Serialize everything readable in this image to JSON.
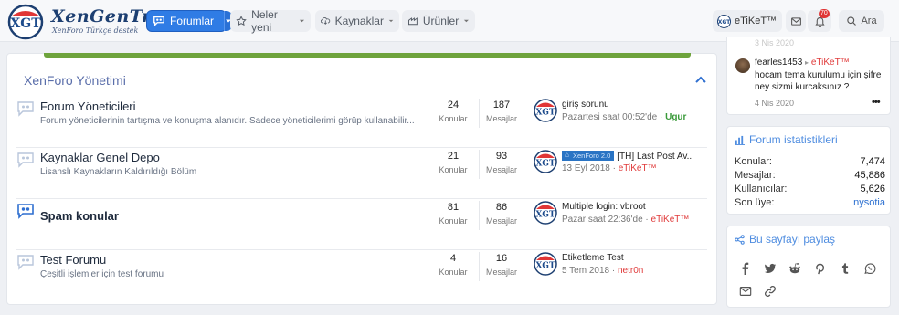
{
  "header": {
    "brand": "XenGenTr",
    "brand_sub": "XenForo Türkçe destek",
    "logo_text": "XGT",
    "nav": {
      "forums": "Forumlar",
      "whats_new": "Neler yeni",
      "resources": "Kaynaklar",
      "products": "Ürünler"
    },
    "user": "eTiKeT™",
    "alerts_count": "70",
    "search": "Ara"
  },
  "category": {
    "title": "XenForo Yönetimi",
    "counts_label": "Konular",
    "messages_label": "Mesajlar",
    "forums": [
      {
        "title": "Forum Yöneticileri",
        "desc": "Forum yöneticilerinin tartışma ve konuşma alanıdır. Sadece yöneticilerimi görüp kullanabilir...",
        "topics": "24",
        "messages": "187",
        "last_title": "giriş sorunu",
        "last_time": "Pazartesi saat 00:52'de · ",
        "last_user": "Ugur",
        "last_user_color": "#3a9a3a"
      },
      {
        "title": "Kaynaklar Genel Depo",
        "desc": "Lisanslı Kaynakların Kaldırıldığı Bölüm",
        "topics": "21",
        "messages": "93",
        "tag": "XenForo 2.0",
        "last_title": "[TH] Last Post Av...",
        "last_time": "13 Eyl 2018 · ",
        "last_user": "eTiKeT™",
        "last_user_color": "#e03a3a"
      },
      {
        "title": "Spam konular",
        "desc": "",
        "topics": "81",
        "messages": "86",
        "last_title": "Multiple login: vbroot",
        "last_time": "Pazar saat 22:36'de · ",
        "last_user": "eTiKeT™",
        "last_user_color": "#e03a3a"
      },
      {
        "title": "Test Forumu",
        "desc": "Çeşitli işlemler için test forumu",
        "topics": "4",
        "messages": "16",
        "last_title": "Etiketleme Test",
        "last_time": "5 Tem 2018 · ",
        "last_user": "netr0n",
        "last_user_color": "#e03a3a"
      }
    ]
  },
  "sidebar": {
    "latest": {
      "top_date": "3 Nis 2020",
      "author": "fearles1453",
      "target": "eTiKeT™",
      "message": "hocam tema kurulumu için şifre ney sizmi kurcaksınız ?",
      "date": "4 Nis 2020",
      "more": "•••"
    },
    "stats": {
      "title": "Forum istatistikleri",
      "rows": [
        {
          "label": "Konular:",
          "value": "7,474"
        },
        {
          "label": "Mesajlar:",
          "value": "45,886"
        },
        {
          "label": "Kullanıcılar:",
          "value": "5,626"
        },
        {
          "label": "Son üye:",
          "value": "nysotia"
        }
      ]
    },
    "share": {
      "title": "Bu sayfayı paylaş",
      "icons": [
        "facebook-icon",
        "twitter-icon",
        "reddit-icon",
        "pinterest-icon",
        "tumblr-icon",
        "whatsapp-icon",
        "email-icon",
        "link-icon"
      ]
    }
  },
  "colors": {
    "accent": "#2f7ce5",
    "section_title": "#5a6eaa",
    "green_bar": "#6ea33c",
    "user_red": "#e03a3a"
  }
}
